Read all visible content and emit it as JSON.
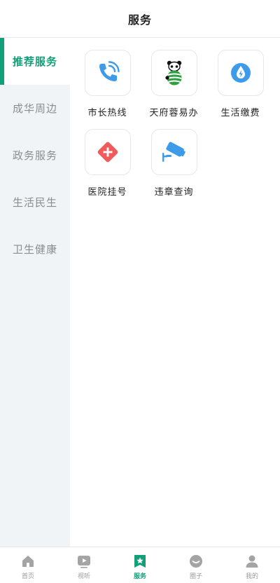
{
  "header": {
    "title": "服务"
  },
  "sidebar": {
    "items": [
      {
        "label": "推荐服务",
        "active": true
      },
      {
        "label": "成华周边"
      },
      {
        "label": "政务服务"
      },
      {
        "label": "生活民生"
      },
      {
        "label": "卫生健康"
      }
    ]
  },
  "services": [
    {
      "label": "市长热线",
      "icon": "phone-icon"
    },
    {
      "label": "天府蓉易办",
      "icon": "panda-icon"
    },
    {
      "label": "生活缴费",
      "icon": "water-drop-icon"
    },
    {
      "label": "医院挂号",
      "icon": "medical-cross-icon"
    },
    {
      "label": "违章查询",
      "icon": "camera-icon"
    }
  ],
  "tabbar": {
    "items": [
      {
        "label": "首页",
        "icon": "home-icon"
      },
      {
        "label": "视听",
        "icon": "video-icon"
      },
      {
        "label": "服务",
        "icon": "star-bookmark-icon",
        "active": true
      },
      {
        "label": "圈子",
        "icon": "chat-icon"
      },
      {
        "label": "我的",
        "icon": "user-icon"
      }
    ]
  },
  "colors": {
    "accent": "#12a07a",
    "blue": "#3d9be9",
    "red": "#f05a5a",
    "green": "#2e9e3e",
    "sidebar_bg": "#f1f4f6"
  }
}
